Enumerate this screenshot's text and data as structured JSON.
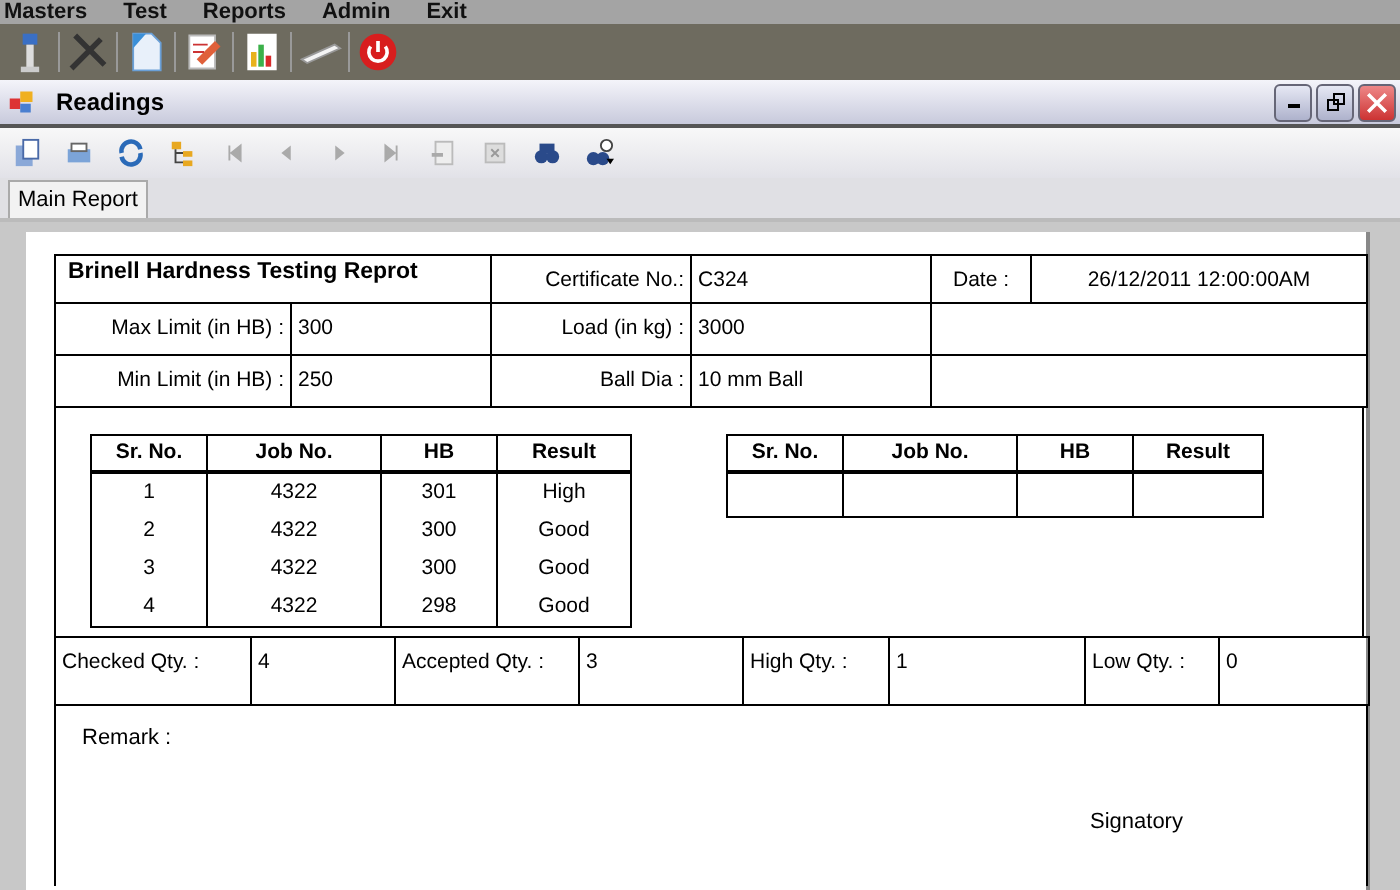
{
  "menu": [
    "Masters",
    "Test",
    "Reports",
    "Admin",
    "Exit"
  ],
  "window": {
    "title": "Readings"
  },
  "tabs": [
    {
      "label": "Main Report",
      "selected": true
    }
  ],
  "report": {
    "title": "Brinell Hardness Testing Reprot",
    "header": [
      {
        "label": "Certificate No.:",
        "value": "C324"
      },
      {
        "label": "Date :",
        "value": "26/12/2011  12:00:00AM"
      }
    ],
    "limits": [
      {
        "label": "Max Limit (in HB) :",
        "value": "300",
        "label2": "Load (in kg) :",
        "value2": "3000"
      },
      {
        "label": "Min  Limit (in HB) :",
        "value": "250",
        "label2": "Ball Dia :",
        "value2": "10 mm Ball"
      }
    ],
    "columns": [
      "Sr. No.",
      "Job No.",
      "HB",
      "Result"
    ],
    "rows": [
      [
        "1",
        "4322",
        "301",
        "High"
      ],
      [
        "2",
        "4322",
        "300",
        "Good"
      ],
      [
        "3",
        "4322",
        "300",
        "Good"
      ],
      [
        "4",
        "4322",
        "298",
        "Good"
      ]
    ],
    "columns_2": [
      "Sr. No.",
      "Job No.",
      "HB",
      "Result"
    ],
    "quantities": [
      {
        "label": "Checked Qty. :",
        "value": "4"
      },
      {
        "label": "Accepted Qty. :",
        "value": "3"
      },
      {
        "label": "High Qty. :",
        "value": "1"
      },
      {
        "label": "Low Qty. :",
        "value": "0"
      }
    ],
    "remark": "Remark :",
    "signatory": "Signatory"
  }
}
